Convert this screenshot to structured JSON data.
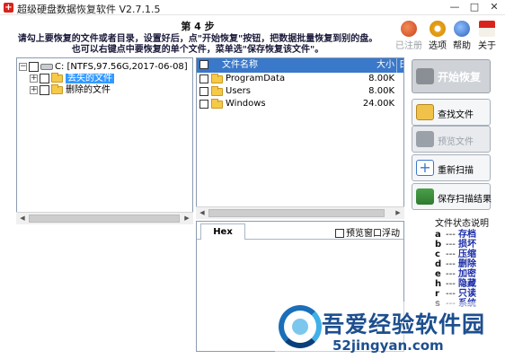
{
  "window": {
    "title": "超级硬盘数据恢复软件 V2.7.1.5",
    "app_icon_glyph": "+",
    "minimize": "—",
    "maximize": "□",
    "close": "✕"
  },
  "header": {
    "step_title": "第 4 步",
    "lines": [
      "请勾上要恢复的文件或者目录，设置好后，点\"开始恢复\"按钮，把数据批量恢复到别的盘。",
      "也可以右键点中要恢复的单个文件，菜单选\"保存恢复该文件\"。"
    ],
    "buttons": [
      {
        "label": "已注册",
        "icon": "registered-icon",
        "color": "#e05a2a",
        "disabled": true
      },
      {
        "label": "选项",
        "icon": "gear-icon",
        "color": "#e9a21a"
      },
      {
        "label": "帮助",
        "icon": "help-icon",
        "color": "#3a78c9"
      },
      {
        "label": "关于",
        "icon": "home-icon",
        "color": "#d8241c"
      }
    ]
  },
  "tree": {
    "root_label": "C: [NTFS,97.56G,2017-06-08]",
    "items": [
      {
        "label": "丢失的文件",
        "selected": true
      },
      {
        "label": "删除的文件",
        "selected": false
      }
    ]
  },
  "file_list": {
    "columns": [
      "文件名称",
      "大小",
      "日"
    ],
    "rows": [
      {
        "name": "ProgramData",
        "size": "8.00K"
      },
      {
        "name": "Users",
        "size": "8.00K"
      },
      {
        "name": "Windows",
        "size": "24.00K"
      }
    ]
  },
  "hex": {
    "tab": "Hex",
    "float_label": "预览窗口浮动"
  },
  "actions": {
    "start": "开始恢复",
    "find": "查找文件",
    "preview": "预览文件",
    "rescan": "重新扫描",
    "save_scan": "保存扫描结果"
  },
  "legend": {
    "title": "文件状态说明",
    "rows": [
      {
        "key": "a",
        "name": "存档"
      },
      {
        "key": "b",
        "name": "损坏"
      },
      {
        "key": "c",
        "name": "压缩"
      },
      {
        "key": "d",
        "name": "删除"
      },
      {
        "key": "e",
        "name": "加密"
      },
      {
        "key": "h",
        "name": "隐藏"
      },
      {
        "key": "r",
        "name": "只读"
      },
      {
        "key": "s",
        "name": "系统"
      }
    ],
    "dash": "---"
  },
  "watermark": {
    "cn": "吾爱经验软件园",
    "en": "52jingyan.com"
  },
  "colors": {
    "header_blue": "#3a78c9",
    "selection": "#3399ff",
    "legend_text": "#1c2ea8"
  }
}
